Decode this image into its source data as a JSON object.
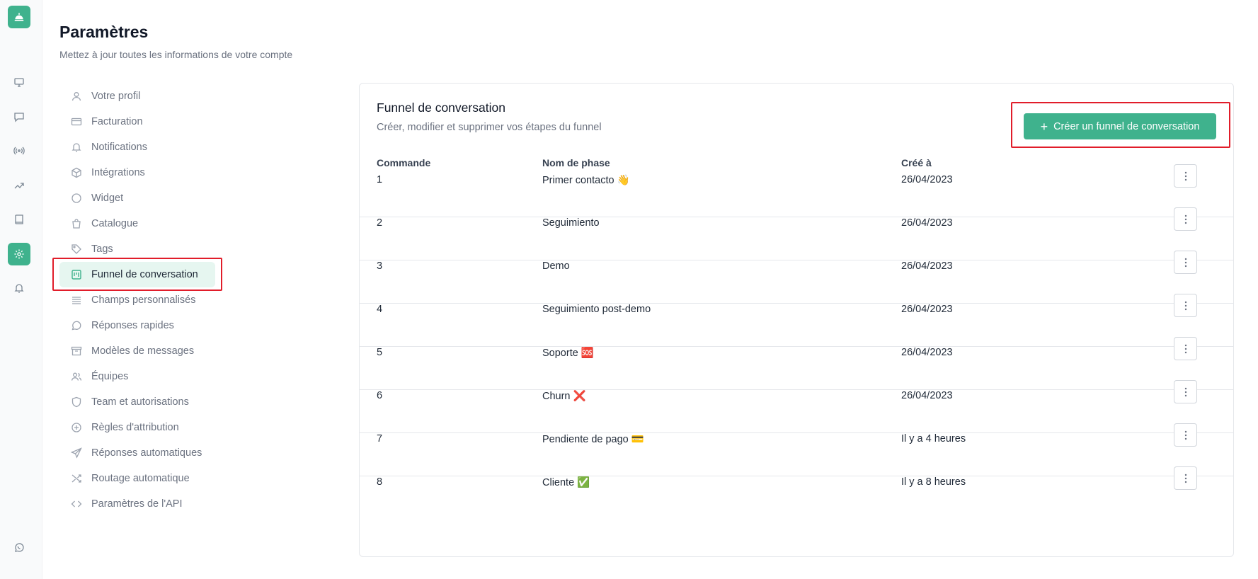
{
  "header": {
    "title": "Paramètres",
    "subtitle": "Mettez à jour toutes les informations de votre compte"
  },
  "rail": {
    "items": [
      "monitor-icon",
      "chat-icon",
      "broadcast-icon",
      "trending-icon",
      "book-icon",
      "gear-icon",
      "bell-icon"
    ],
    "active": "gear-icon",
    "bottom": "whatsapp-icon"
  },
  "menu": {
    "items": [
      {
        "label": "Votre profil",
        "icon": "user-icon"
      },
      {
        "label": "Facturation",
        "icon": "credit-card-icon"
      },
      {
        "label": "Notifications",
        "icon": "bell-icon"
      },
      {
        "label": "Intégrations",
        "icon": "cube-icon"
      },
      {
        "label": "Widget",
        "icon": "circle-icon"
      },
      {
        "label": "Catalogue",
        "icon": "shopping-bag-icon"
      },
      {
        "label": "Tags",
        "icon": "tag-icon"
      },
      {
        "label": "Funnel de conversation",
        "icon": "kanban-icon"
      },
      {
        "label": "Champs personnalisés",
        "icon": "lines-icon"
      },
      {
        "label": "Réponses rapides",
        "icon": "message-circle-icon"
      },
      {
        "label": "Modèles de messages",
        "icon": "archive-icon"
      },
      {
        "label": "Équipes",
        "icon": "users-icon"
      },
      {
        "label": "Team et autorisations",
        "icon": "shield-icon"
      },
      {
        "label": "Règles d'attribution",
        "icon": "plus-circle-icon"
      },
      {
        "label": "Réponses automatiques",
        "icon": "send-icon"
      },
      {
        "label": "Routage automatique",
        "icon": "shuffle-icon"
      },
      {
        "label": "Paramètres de l'API",
        "icon": "code-icon"
      }
    ],
    "active_index": 7
  },
  "card": {
    "title": "Funnel de conversation",
    "subtitle": "Créer, modifier et supprimer vos étapes du funnel",
    "create_button": "Créer un funnel de conversation",
    "columns": [
      "Commande",
      "Nom de phase",
      "Créé à"
    ],
    "rows": [
      {
        "order": "1",
        "name": "Primer contacto 👋",
        "created": "26/04/2023"
      },
      {
        "order": "2",
        "name": "Seguimiento",
        "created": "26/04/2023"
      },
      {
        "order": "3",
        "name": "Demo",
        "created": "26/04/2023"
      },
      {
        "order": "4",
        "name": "Seguimiento post-demo",
        "created": "26/04/2023"
      },
      {
        "order": "5",
        "name": "Soporte 🆘",
        "created": "26/04/2023"
      },
      {
        "order": "6",
        "name": "Churn ❌",
        "created": "26/04/2023"
      },
      {
        "order": "7",
        "name": "Pendiente de pago 💳",
        "created": "Il y a 4 heures"
      },
      {
        "order": "8",
        "name": "Cliente ✅",
        "created": "Il y a 8 heures"
      }
    ]
  },
  "colors": {
    "accent": "#3fb28d",
    "highlight": "#e11d2a"
  }
}
